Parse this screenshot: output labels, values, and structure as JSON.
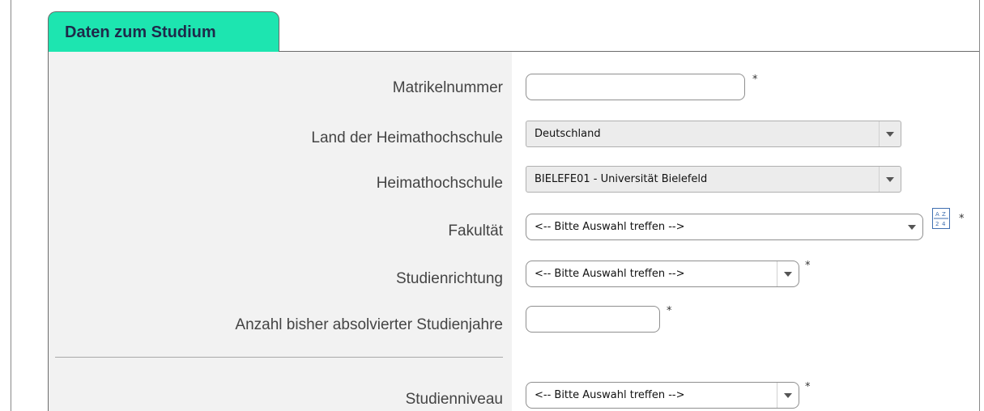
{
  "section": {
    "tab_label": "Daten zum Studium"
  },
  "form": {
    "required_marker": "*",
    "matrikelnummer": {
      "label": "Matrikelnummer",
      "value": ""
    },
    "land": {
      "label": "Land der Heimathochschule",
      "value": "Deutschland"
    },
    "hochschule": {
      "label": "Heimathochschule",
      "value": "BIELEFE01 - Universität Bielefeld"
    },
    "fakultaet": {
      "label": "Fakultät",
      "value": "<-- Bitte Auswahl treffen -->",
      "lookup_icon": "sort-az-icon"
    },
    "studienrichtung": {
      "label": "Studienrichtung",
      "value": "<-- Bitte Auswahl treffen -->"
    },
    "studienjahre": {
      "label": "Anzahl bisher absolvierter Studienjahre",
      "value": ""
    },
    "studienniveau": {
      "label": "Studienniveau",
      "value": "<-- Bitte Auswahl treffen -->"
    }
  },
  "colors": {
    "tab_accent": "#1de5b0",
    "panel_bg": "#f2f2f2",
    "icon_blue": "#3f6fb0"
  }
}
